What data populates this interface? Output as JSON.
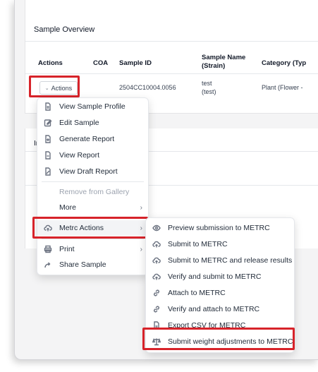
{
  "panel": {
    "title": "Sample Overview",
    "columns": [
      "Actions",
      "COA",
      "Sample ID",
      "Sample Name (Strain)",
      "Category (Typ"
    ],
    "row": {
      "actions_label": "Actions",
      "sample_id": "2504CC10004.0056",
      "sample_name": "test",
      "strain": "(test)",
      "category": "Plant (Flower -"
    }
  },
  "panel2": {
    "title_fragment": "In"
  },
  "menu": {
    "items": [
      {
        "label": "View Sample Profile",
        "icon": "document-icon"
      },
      {
        "label": "Edit Sample",
        "icon": "edit-icon"
      },
      {
        "label": "Generate Report",
        "icon": "generate-report-icon"
      },
      {
        "label": "View Report",
        "icon": "document-icon"
      },
      {
        "label": "View Draft Report",
        "icon": "draft-report-icon"
      }
    ],
    "remove_label": "Remove from Gallery",
    "more_label": "More",
    "metrc_label": "Metrc Actions",
    "print_label": "Print",
    "share_label": "Share Sample"
  },
  "submenu": {
    "items": [
      {
        "label": "Preview submission to METRC",
        "icon": "eye-icon"
      },
      {
        "label": "Submit to METRC",
        "icon": "cloud-upload-icon"
      },
      {
        "label": "Submit to METRC and release results",
        "icon": "cloud-upload-icon"
      },
      {
        "label": "Verify and submit to METRC",
        "icon": "cloud-upload-icon"
      },
      {
        "label": "Attach to METRC",
        "icon": "link-icon"
      },
      {
        "label": "Verify and attach to METRC",
        "icon": "link-icon"
      },
      {
        "label": "Export CSV for METRC",
        "icon": "document-icon"
      },
      {
        "label": "Submit weight adjustments to METRC",
        "icon": "scale-icon"
      }
    ]
  },
  "colors": {
    "highlight": "#d7232a",
    "metrc_row_bg": "#f3f4f6"
  }
}
